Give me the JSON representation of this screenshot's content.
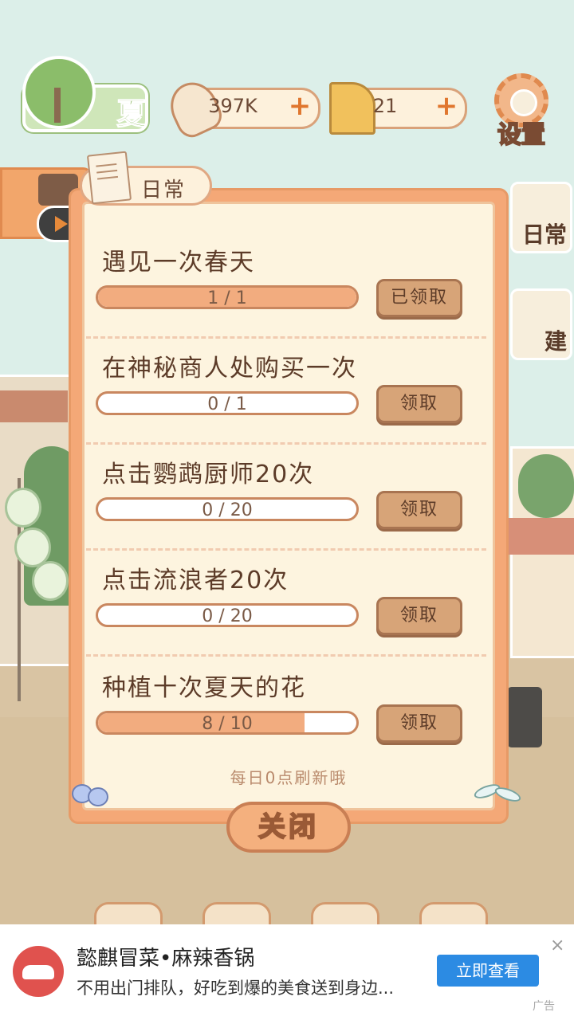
{
  "hud": {
    "season_label": "夏",
    "fish_value": "397K",
    "cheese_value": "21",
    "plus": "+",
    "settings_label": "设置"
  },
  "side_buttons": {
    "daily_label": "日常",
    "build_label": "建"
  },
  "panel": {
    "tab_label": "日常",
    "refresh_note": "每日0点刷新哦",
    "close_label": "关闭",
    "tasks": [
      {
        "title": "遇见一次春天",
        "progress_text": "1 / 1",
        "progress": 1.0,
        "button": "已领取"
      },
      {
        "title": "在神秘商人处购买一次",
        "progress_text": "0 / 1",
        "progress": 0.0,
        "button": "领取"
      },
      {
        "title": "点击鹦鹉厨师20次",
        "progress_text": "0 / 20",
        "progress": 0.0,
        "button": "领取"
      },
      {
        "title": "点击流浪者20次",
        "progress_text": "0 / 20",
        "progress": 0.0,
        "button": "领取"
      },
      {
        "title": "种植十次夏天的花",
        "progress_text": "8 / 10",
        "progress": 0.8,
        "button": "领取"
      }
    ]
  },
  "ad": {
    "title": "懿麒冒菜•麻辣香锅",
    "description": "不用出门排队，好吃到爆的美食送到身边...",
    "cta": "立即查看",
    "close": "×",
    "tag": "广告"
  },
  "colors": {
    "panel_border": "#f4a877",
    "panel_bg": "#fdf4df",
    "progress_fill": "#f2ac7f",
    "button_bg": "#d7a478",
    "ad_cta": "#2c8be3"
  }
}
